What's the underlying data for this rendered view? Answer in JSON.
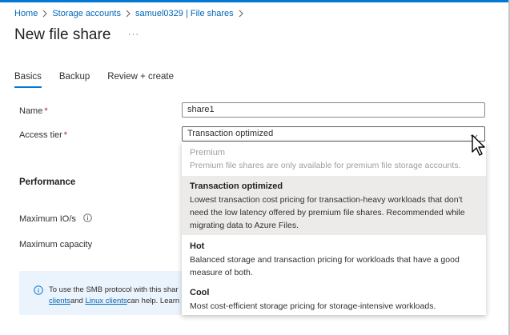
{
  "breadcrumb": {
    "items": [
      "Home",
      "Storage accounts",
      "samuel0329 | File shares"
    ]
  },
  "page": {
    "title": "New file share",
    "more_label": "···"
  },
  "tabs": [
    "Basics",
    "Backup",
    "Review + create"
  ],
  "form": {
    "name_label": "Name",
    "name_value": "share1",
    "access_tier_label": "Access tier",
    "access_tier_value": "Transaction optimized",
    "required_mark": "*"
  },
  "performance": {
    "title": "Performance",
    "max_io_label": "Maximum IO/s",
    "max_capacity_label": "Maximum capacity"
  },
  "info_banner": {
    "line1": "To use the SMB protocol with this shar",
    "link1": "clients",
    "mid": "and ",
    "link2": "Linux clients",
    "tail": "can help. Learn"
  },
  "dropdown": {
    "options": [
      {
        "title": "Premium",
        "desc": "Premium file shares are only available for premium file storage accounts.",
        "state": "disabled"
      },
      {
        "title": "Transaction optimized",
        "desc": "Lowest transaction cost pricing for transaction-heavy workloads that don't need the low latency offered by premium file shares. Recommended while migrating data to Azure Files.",
        "state": "selected"
      },
      {
        "title": "Hot",
        "desc": "Balanced storage and transaction pricing for workloads that have a good measure of both.",
        "state": "normal"
      },
      {
        "title": "Cool",
        "desc": "Most cost-efficient storage pricing for storage-intensive workloads.",
        "state": "normal"
      }
    ]
  },
  "colors": {
    "accent": "#0078d4",
    "link": "#0067b8",
    "required": "#a4262c",
    "selected_bg": "#edebe9",
    "info_bg": "#ebf3fc"
  }
}
